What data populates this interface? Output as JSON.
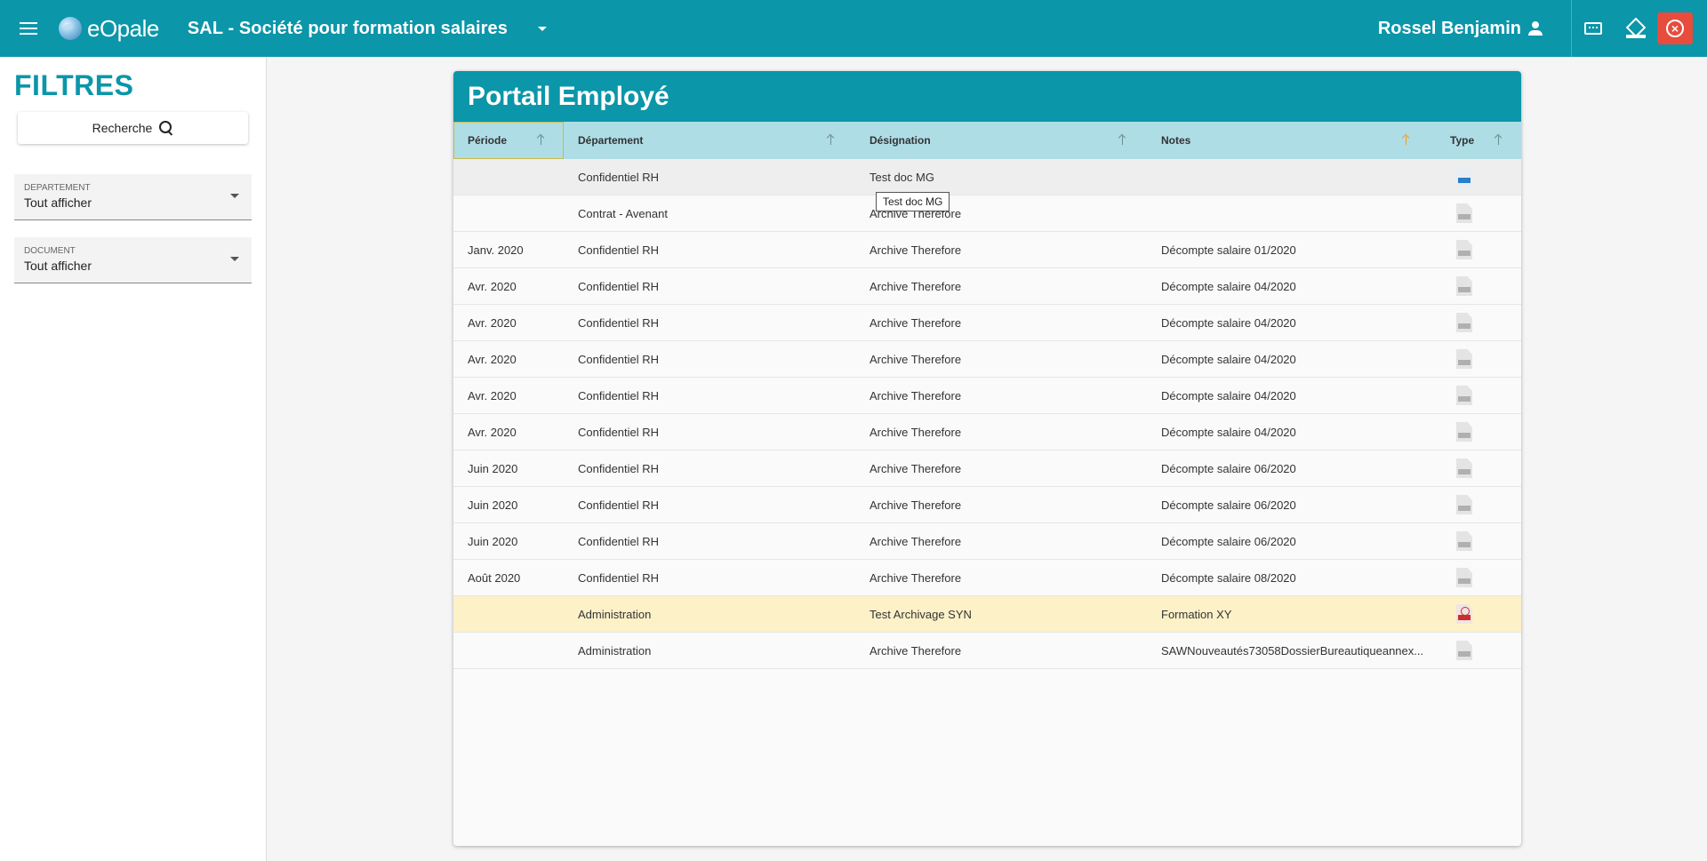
{
  "topbar": {
    "logo_text": "eOpale",
    "company": "SAL - Société pour formation salaires",
    "user_name": "Rossel Benjamin"
  },
  "sidebar": {
    "title": "FILTRES",
    "search_label": "Recherche",
    "department": {
      "label": "DEPARTEMENT",
      "value": "Tout afficher"
    },
    "document": {
      "label": "DOCUMENT",
      "value": "Tout afficher"
    }
  },
  "panel": {
    "title": "Portail Employé",
    "columns": [
      "Période",
      "Département",
      "Désignation",
      "Notes",
      "Type"
    ],
    "rows": [
      {
        "periode": "",
        "departement": "Confidentiel RH",
        "designation": "Test doc MG",
        "notes": "",
        "type": "doc-file-icon"
      },
      {
        "periode": "",
        "departement": "Contrat - Avenant",
        "designation": "Archive Therefore",
        "notes": "",
        "type": "generic-file-icon"
      },
      {
        "periode": "Janv. 2020",
        "departement": "Confidentiel RH",
        "designation": "Archive Therefore",
        "notes": "Décompte salaire 01/2020",
        "type": "generic-file-icon"
      },
      {
        "periode": "Avr. 2020",
        "departement": "Confidentiel RH",
        "designation": "Archive Therefore",
        "notes": "Décompte salaire 04/2020",
        "type": "generic-file-icon"
      },
      {
        "periode": "Avr. 2020",
        "departement": "Confidentiel RH",
        "designation": "Archive Therefore",
        "notes": "Décompte salaire 04/2020",
        "type": "generic-file-icon"
      },
      {
        "periode": "Avr. 2020",
        "departement": "Confidentiel RH",
        "designation": "Archive Therefore",
        "notes": "Décompte salaire 04/2020",
        "type": "generic-file-icon"
      },
      {
        "periode": "Avr. 2020",
        "departement": "Confidentiel RH",
        "designation": "Archive Therefore",
        "notes": "Décompte salaire 04/2020",
        "type": "generic-file-icon"
      },
      {
        "periode": "Avr. 2020",
        "departement": "Confidentiel RH",
        "designation": "Archive Therefore",
        "notes": "Décompte salaire 04/2020",
        "type": "generic-file-icon"
      },
      {
        "periode": "Juin 2020",
        "departement": "Confidentiel RH",
        "designation": "Archive Therefore",
        "notes": "Décompte salaire 06/2020",
        "type": "generic-file-icon"
      },
      {
        "periode": "Juin 2020",
        "departement": "Confidentiel RH",
        "designation": "Archive Therefore",
        "notes": "Décompte salaire 06/2020",
        "type": "generic-file-icon"
      },
      {
        "periode": "Juin 2020",
        "departement": "Confidentiel RH",
        "designation": "Archive Therefore",
        "notes": "Décompte salaire 06/2020",
        "type": "generic-file-icon"
      },
      {
        "periode": "Août 2020",
        "departement": "Confidentiel RH",
        "designation": "Archive Therefore",
        "notes": "Décompte salaire 08/2020",
        "type": "generic-file-icon"
      },
      {
        "periode": "",
        "departement": "Administration",
        "designation": "Test Archivage SYN",
        "notes": "Formation XY",
        "type": "pdf-file-icon"
      },
      {
        "periode": "",
        "departement": "Administration",
        "designation": "Archive Therefore",
        "notes": "SAWNouveautés73058DossierBureautiqueannex...",
        "type": "generic-file-icon"
      }
    ]
  },
  "tooltip": {
    "text": "Test doc MG"
  },
  "colors": {
    "primary": "#0b96a9",
    "header_row": "#aedde6",
    "highlight_row": "#fdf1c8",
    "close_button": "#e74c3c"
  }
}
